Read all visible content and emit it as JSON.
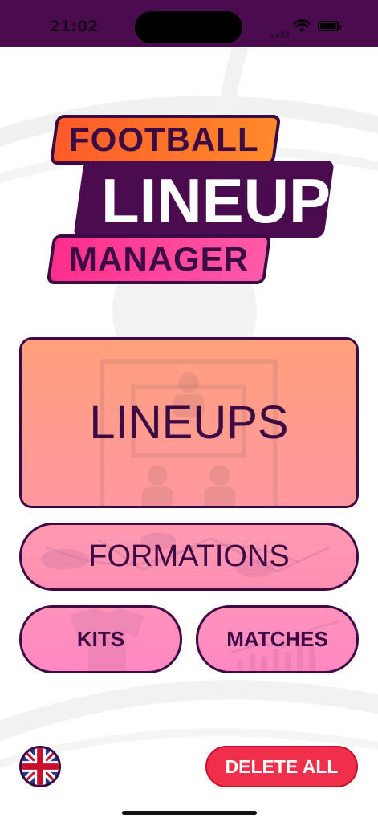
{
  "status_bar": {
    "time": "21:02",
    "icons": [
      "signal-icon",
      "wifi-icon",
      "battery-icon"
    ]
  },
  "logo": {
    "line1": "FOOTBALL",
    "line2": "LINEUP",
    "line3": "MANAGER"
  },
  "menu": {
    "lineups_label": "LINEUPS",
    "formations_label": "FORMATIONS",
    "kits_label": "KITS",
    "matches_label": "MATCHES"
  },
  "footer": {
    "language_flag": "uk-flag-icon",
    "delete_all_label": "DELETE ALL"
  },
  "colors": {
    "header": "#4a0c4e",
    "text_dark": "#3d0b44",
    "orange": "#ff6a2a",
    "pink": "#ff3d96",
    "delete_red": "#f0304a"
  }
}
